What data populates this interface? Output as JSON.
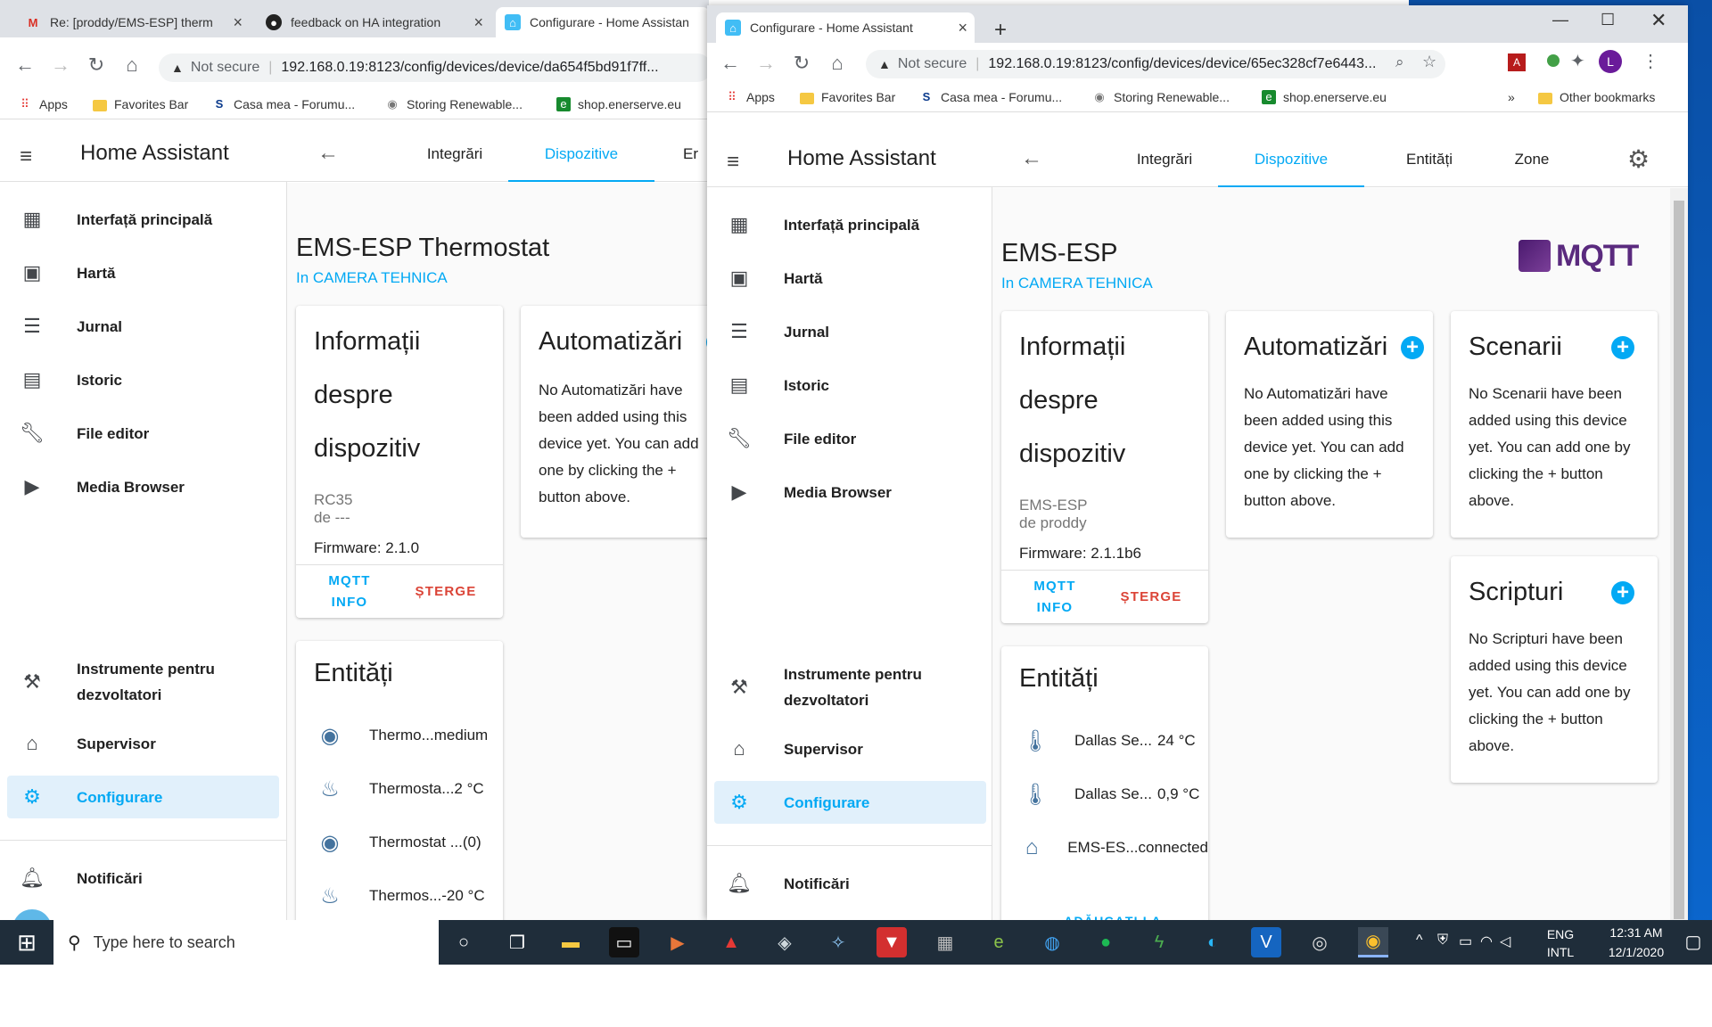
{
  "browser_left": {
    "tabs": [
      {
        "title": "Re: [proddy/EMS-ESP] therm",
        "icon": "gmail-icon"
      },
      {
        "title": "feedback on HA integration",
        "icon": "github-icon"
      },
      {
        "title": "Configurare - Home Assistan",
        "icon": "home-assistant-icon"
      }
    ],
    "address": {
      "not_secure": "Not secure",
      "url": "192.168.0.19:8123/config/devices/device/da654f5bd91f7ff..."
    },
    "bookmarks": [
      "Apps",
      "Favorites Bar",
      "Casa mea - Forumu...",
      "Storing Renewable...",
      "shop.enerserve.eu"
    ]
  },
  "browser_right": {
    "tab": {
      "title": "Configurare - Home Assistant",
      "icon": "home-assistant-icon"
    },
    "address": {
      "not_secure": "Not secure",
      "url": "192.168.0.19:8123/config/devices/device/65ec328cf7e6443..."
    },
    "bookmarks": [
      "Apps",
      "Favorites Bar",
      "Casa mea - Forumu...",
      "Storing Renewable...",
      "shop.enerserve.eu"
    ],
    "more": "»",
    "other_bookmarks": "Other bookmarks",
    "profile_initial": "L"
  },
  "ha": {
    "title": "Home Assistant",
    "sidebar": [
      "Interfață principală",
      "Hartă",
      "Jurnal",
      "Istoric",
      "File editor",
      "Media Browser"
    ],
    "dev_tools": "Instrumente pentru dezvoltatori",
    "supervisor": "Supervisor",
    "configurare": "Configurare",
    "notificari": "Notificări",
    "tabs_left": [
      "Integrări",
      "Dispozitive",
      "Er"
    ],
    "tabs_right": [
      "Integrări",
      "Dispozitive",
      "Entități",
      "Zone"
    ]
  },
  "left_device": {
    "name": "EMS-ESP Thermostat",
    "area": "In CAMERA TEHNICA",
    "info_title": "Informații despre dispozitiv",
    "model": "RC35",
    "manufacturer": "de ---",
    "firmware": "Firmware: 2.1.0",
    "btn_mqtt_1": "MQTT",
    "btn_mqtt_2": "INFO",
    "btn_delete": "ȘTERGE",
    "automations_title": "Automatizări",
    "automations_text": "No Automatizări have been added using this device yet. You can add one by clicking the + button above.",
    "entities_title": "Entități",
    "entities": [
      {
        "name": "Thermo...",
        "value": "medium",
        "icon": "eye-icon"
      },
      {
        "name": "Thermosta...",
        "value": "2 °C",
        "icon": "heat-wave-icon"
      },
      {
        "name": "Thermostat ...",
        "value": "(0)",
        "icon": "eye-icon"
      },
      {
        "name": "Thermos...",
        "value": "-20 °C",
        "icon": "heat-wave-icon"
      }
    ]
  },
  "right_device": {
    "name": "EMS-ESP",
    "area": "In CAMERA TEHNICA",
    "logo": "MQTT",
    "info_title": "Informații despre dispozitiv",
    "model": "EMS-ESP",
    "manufacturer": "de proddy",
    "firmware": "Firmware: 2.1.1b6",
    "btn_mqtt_1": "MQTT",
    "btn_mqtt_2": "INFO",
    "btn_delete": "ȘTERGE",
    "automations_title": "Automatizări",
    "automations_text": "No Automatizări have been added using this device yet. You can add one by clicking the + button above.",
    "scenes_title": "Scenarii",
    "scenes_text": "No Scenarii have been added using this device yet. You can add one by clicking the + button above.",
    "scripts_title": "Scripturi",
    "scripts_text": "No Scripturi have been added using this device yet. You can add one by clicking the + button above.",
    "entities_title": "Entități",
    "entities": [
      {
        "name": "Dallas Se...",
        "value": "24 °C",
        "icon": "thermometer-icon"
      },
      {
        "name": "Dallas Se...",
        "value": "0,9 °C",
        "icon": "thermometer-icon"
      },
      {
        "name": "EMS-ES...",
        "value": "connected",
        "icon": "home-outline-icon"
      }
    ],
    "add_partial": "ADĂUGAȚI LA"
  },
  "taskbar": {
    "search_placeholder": "Type here to search",
    "lang_1": "ENG",
    "lang_2": "INTL",
    "time": "12:31 AM",
    "date": "12/1/2020"
  },
  "colors": {
    "accent": "#03a9f4",
    "delete": "#db4437",
    "taskbar": "#1f2d3a"
  }
}
